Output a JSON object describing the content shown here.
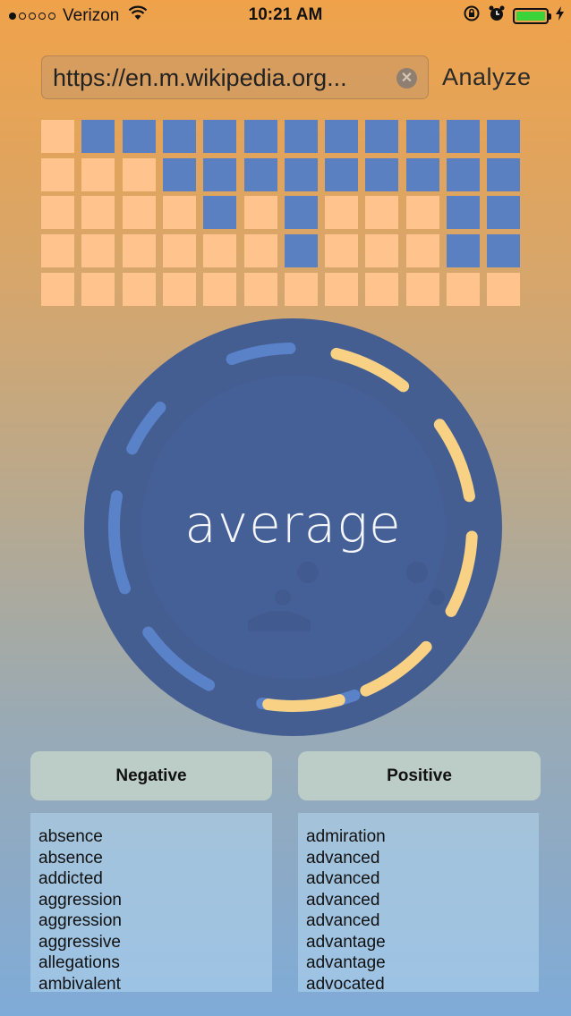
{
  "status_bar": {
    "carrier": "Verizon",
    "time": "10:21 AM",
    "signal_bars_filled": 1,
    "signal_bars_total": 5,
    "battery_level": 1.0,
    "icons": [
      "wifi-icon",
      "rotation-lock-icon",
      "alarm-icon",
      "battery-icon",
      "charging-bolt-icon"
    ]
  },
  "search": {
    "url": "https://en.m.wikipedia.org...",
    "clear_icon": "clear-icon",
    "analyze_label": "Analyze"
  },
  "colors": {
    "grid_blue": "#5A80C2",
    "grid_peach": "#FFC48E",
    "dial_fill": "#445E92",
    "dash_blue": "#5A82C9",
    "dash_yellow": "#F8D184",
    "header_bg": "#BCCCC7"
  },
  "grid": {
    "rows": 5,
    "cols": 12,
    "cells": [
      [
        0,
        1,
        1,
        1,
        1,
        1,
        1,
        1,
        1,
        1,
        1,
        1
      ],
      [
        0,
        0,
        0,
        1,
        1,
        1,
        1,
        1,
        1,
        1,
        1,
        1
      ],
      [
        0,
        0,
        0,
        0,
        1,
        0,
        1,
        0,
        0,
        0,
        1,
        1
      ],
      [
        0,
        0,
        0,
        0,
        0,
        0,
        1,
        0,
        0,
        0,
        1,
        1
      ],
      [
        0,
        0,
        0,
        0,
        0,
        0,
        0,
        0,
        0,
        0,
        0,
        0
      ]
    ]
  },
  "sentiment": {
    "label": "average",
    "face_icon": "sad-face-icon"
  },
  "negative": {
    "header": "Negative",
    "words": [
      "absence",
      "absence",
      "addicted",
      "aggression",
      "aggression",
      "aggressive",
      "allegations",
      "ambivalent"
    ]
  },
  "positive": {
    "header": "Positive",
    "words": [
      "admiration",
      "advanced",
      "advanced",
      "advanced",
      "advanced",
      "advantage",
      "advantage",
      "advocated"
    ]
  }
}
